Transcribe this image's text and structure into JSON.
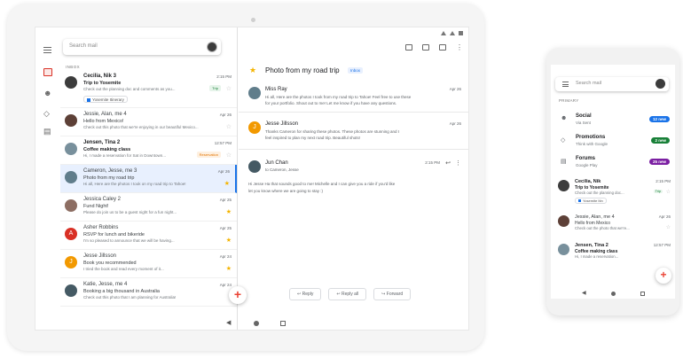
{
  "colors": {
    "accent": "#1a73e8",
    "star": "#f4b400",
    "inbox_red": "#d93025",
    "social_badge": "#1a73e8",
    "promo_badge": "#188038",
    "forums_badge": "#7b1fa2"
  },
  "tablet": {
    "status_time": "",
    "search": {
      "placeholder": "Search mail"
    },
    "section_label": "INBOX",
    "mails": [
      {
        "from": "Cecilia, Nik 3",
        "time": "2:15 PM",
        "subject": "Trip to Yosemite",
        "snippet": "Check out the planning doc and comments as you...",
        "tag": "Trip",
        "attachment": "Yosemite Itinerary",
        "avatar_color": "#3c3c3c",
        "avatar_letter": "",
        "unread": true,
        "starred": false
      },
      {
        "from": "Jessie, Alan, me 4",
        "time": "Apr 26",
        "subject": "Hello from Mexico!",
        "snippet": "Check out this photo that we're enjoying in our beautiful Mexico...",
        "tag": "",
        "avatar_color": "#5d4037",
        "avatar_letter": "",
        "unread": false,
        "starred": false
      },
      {
        "from": "Jensen, Tina 2",
        "time": "12:57 PM",
        "subject": "Coffee making class",
        "snippet": "Hi, I made a reservation for Sat in Downtown...",
        "tag": "Reservation",
        "avatar_color": "#78909c",
        "avatar_letter": "",
        "unread": true,
        "starred": false
      },
      {
        "from": "Cameron, Jesse, me 3",
        "time": "Apr 26",
        "subject": "Photo from my road trip",
        "snippet": "Hi all, Here are the photos I took on my road trip to Tahoe!",
        "tag": "",
        "avatar_color": "#607d8b",
        "avatar_letter": "",
        "unread": false,
        "starred": true
      },
      {
        "from": "Jessica Caley 2",
        "time": "Apr 25",
        "subject": "Fund Night!",
        "snippet": "Please do join us to be a guest night for a fun night...",
        "tag": "",
        "avatar_color": "#8d6e63",
        "avatar_letter": "",
        "unread": false,
        "starred": true
      },
      {
        "from": "Asher Robbins",
        "time": "Apr 25",
        "subject": "RSVP for lunch and bikeride",
        "snippet": "I'm so pleased to announce that we will be having...",
        "tag": "",
        "avatar_color": "#d93025",
        "avatar_letter": "A",
        "unread": false,
        "starred": true
      },
      {
        "from": "Jesse Jillsson",
        "time": "Apr 24",
        "subject": "Book you recommended",
        "snippet": "I tried the book and read every moment of it...",
        "tag": "",
        "avatar_color": "#f29900",
        "avatar_letter": "J",
        "unread": false,
        "starred": true
      },
      {
        "from": "Katie, Jesse, me 4",
        "time": "Apr 24",
        "subject": "Booking a big thousand in Australia",
        "snippet": "Check out this photo that I am planning for Australia!",
        "tag": "",
        "avatar_color": "#455a64",
        "avatar_letter": "",
        "unread": false,
        "starred": false
      }
    ],
    "fab_label": "+",
    "thread": {
      "title": "Photo from my road trip",
      "badge": "Inbox",
      "messages": [
        {
          "from": "Miss Ray",
          "time": "Apr 26",
          "lines": [
            "Hi all, Here are the photos I took from my road trip to Tahoe! Feel free to use these",
            "for your portfolio. Shout out to me! Let me know if you have any questions."
          ],
          "avatar_color": "#607d8b",
          "avatar_letter": ""
        },
        {
          "from": "Jesse Jillsson",
          "time": "Apr 26",
          "lines": [
            "Thanks Cameron for sharing these photos. These photos are stunning and I",
            "feel inspired to plan my next road trip. Beautiful shots!"
          ],
          "avatar_color": "#f29900",
          "avatar_letter": "J"
        },
        {
          "from": "Jun Chan",
          "time": "2:15 PM",
          "to": "to Cameron, Jesse",
          "lines": [
            "Hi Jesse Ha that sounds good to me! Michelle and I can give you a ride if you'd like",
            "let you know where we are going to stay :)"
          ],
          "avatar_color": "#455a64",
          "avatar_letter": ""
        }
      ],
      "reply_buttons": [
        "Reply",
        "Reply all",
        "Forward"
      ]
    }
  },
  "phone": {
    "search": {
      "placeholder": "Search mail"
    },
    "section_label": "PRIMARY",
    "categories": [
      {
        "name": "Social",
        "sub": "Via Sent",
        "badge": "12 new",
        "icon": "social-icon",
        "badge_color": "#1a73e8"
      },
      {
        "name": "Promotions",
        "sub": "Think with Google",
        "badge": "2 new",
        "icon": "promotions-icon",
        "badge_color": "#188038"
      },
      {
        "name": "Forums",
        "sub": "Google Play",
        "badge": "25 new",
        "icon": "forums-icon",
        "badge_color": "#7b1fa2"
      }
    ],
    "mails": [
      {
        "from": "Cecilia, Nik",
        "time": "2:15 PM",
        "subject": "Trip to Yosemite",
        "snippet": "Check out the planning doc...",
        "tag": "Trip",
        "attachment": "Yosemite Itin",
        "avatar_color": "#3c3c3c",
        "unread": true
      },
      {
        "from": "Jessie, Alan, me 4",
        "time": "Apr 26",
        "subject": "Hello from Mexico",
        "snippet": "Check out the photo that we're...",
        "tag": "",
        "avatar_color": "#5d4037",
        "unread": false
      },
      {
        "from": "Jensen, Tina 2",
        "time": "12:57 PM",
        "subject": "Coffee making class",
        "snippet": "Hi, I made a reservation...",
        "tag": "",
        "avatar_color": "#78909c",
        "unread": true
      }
    ],
    "fab_label": "+"
  }
}
